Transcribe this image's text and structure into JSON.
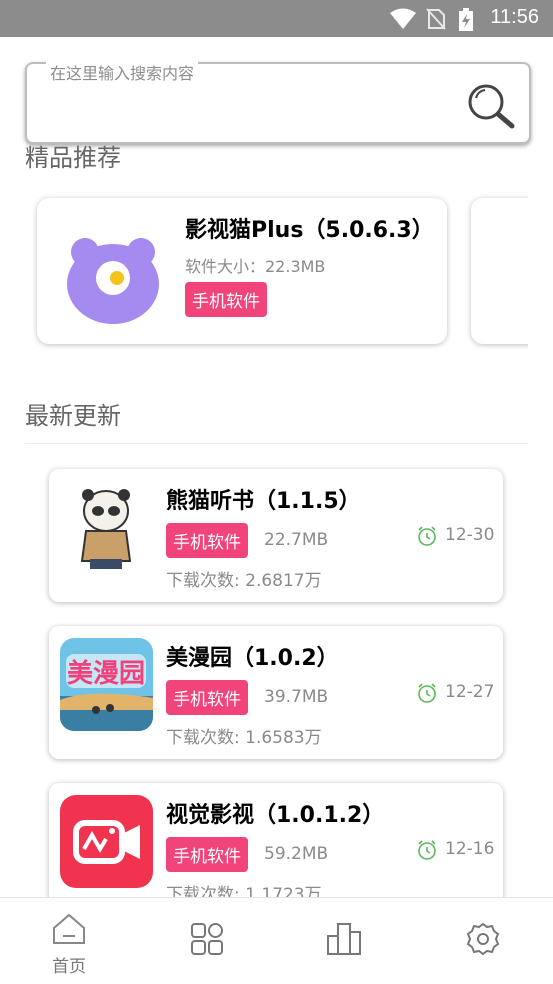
{
  "status_bar": {
    "time": "11:56",
    "icons": [
      "wifi-icon",
      "no-sim-icon",
      "battery-charging-icon"
    ]
  },
  "search": {
    "placeholder": "在这里输入搜索内容",
    "icon": "search-icon"
  },
  "featured": {
    "title": "精品推荐",
    "items": [
      {
        "name": "影视猫Plus（5.0.6.3）",
        "size": "软件大小：22.3MB",
        "tag": "手机软件",
        "icon": "cat-app-icon"
      }
    ]
  },
  "latest": {
    "title": "最新更新",
    "items": [
      {
        "name": "熊猫听书（1.1.5）",
        "tag": "手机软件",
        "size": "22.7MB",
        "date": "12-30",
        "downloads": "下载次数: 2.6817万",
        "icon": "panda-app-icon"
      },
      {
        "name": "美漫园（1.0.2）",
        "tag": "手机软件",
        "size": "39.7MB",
        "date": "12-27",
        "downloads": "下载次数: 1.6583万",
        "icon": "meimanyuan-app-icon"
      },
      {
        "name": "视觉影视（1.0.1.2）",
        "tag": "手机软件",
        "size": "59.2MB",
        "date": "12-16",
        "downloads": "下载次数: 1.1723万",
        "icon": "video-app-icon"
      }
    ]
  },
  "bottom_nav": {
    "items": [
      {
        "label": "首页",
        "icon": "home-icon"
      },
      {
        "label": "",
        "icon": "apps-grid-icon"
      },
      {
        "label": "",
        "icon": "ranking-chart-icon"
      },
      {
        "label": "",
        "icon": "settings-gear-icon"
      }
    ]
  },
  "colors": {
    "tag": "#f0447a",
    "status_bar": "#8c8c8c",
    "clock": "#5cb85c"
  }
}
